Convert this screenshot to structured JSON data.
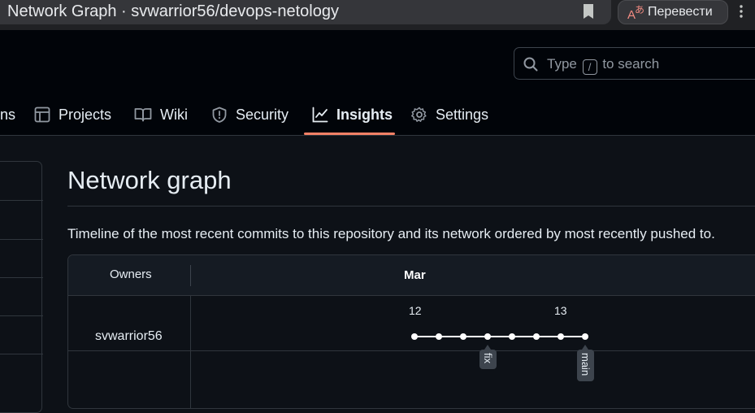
{
  "browser": {
    "tab_title": "Network Graph · svwarrior56/devops-netology",
    "translate_label": "Перевести"
  },
  "header": {
    "search": {
      "prefix": "Type",
      "key": "/",
      "suffix": "to search"
    },
    "tabs": [
      {
        "label": "ns",
        "icon": "truncated"
      },
      {
        "label": "Projects",
        "icon": "table-icon"
      },
      {
        "label": "Wiki",
        "icon": "book-icon"
      },
      {
        "label": "Security",
        "icon": "shield-icon"
      },
      {
        "label": "Insights",
        "icon": "graph-icon",
        "active": true
      },
      {
        "label": "Settings",
        "icon": "gear-icon"
      }
    ],
    "active_accent": "#f78166"
  },
  "main": {
    "title": "Network graph",
    "description": "Timeline of the most recent commits to this repository and its network ordered by most recently pushed to.",
    "graph": {
      "owners_header": "Owners",
      "month": "Mar",
      "days": [
        "12",
        "13"
      ],
      "owner": "svwarrior56",
      "commit_count": 8,
      "branches": [
        {
          "name": "fix",
          "commit_index": 3
        },
        {
          "name": "main",
          "commit_index": 7
        }
      ]
    }
  }
}
